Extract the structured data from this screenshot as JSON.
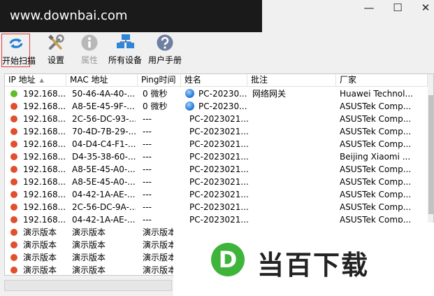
{
  "watermark": {
    "url_text": "www.downbai.com",
    "logo_letter": "D",
    "logo_text": "当百下载"
  },
  "window": {
    "minimize": "—",
    "maximize": "☐",
    "close": "✕"
  },
  "toolbar": {
    "start_scan": "开始扫描",
    "settings": "设置",
    "properties": "属性",
    "all_devices": "所有设备",
    "user_manual": "用户手册"
  },
  "columns": [
    "IP 地址",
    "MAC 地址",
    "Ping时间",
    "姓名",
    "批注",
    "厂家"
  ],
  "rows": [
    {
      "status": "green",
      "ip": "192.168...",
      "mac": "50-46-4A-40-...",
      "ping": "0 微秒",
      "name": "PC-20230...",
      "has_globe": true,
      "note": "网络网关",
      "vendor": "Huawei Technol..."
    },
    {
      "status": "red",
      "ip": "192.168...",
      "mac": "A8-5E-45-9F-...",
      "ping": "0 微秒",
      "name": "PC-20230...",
      "has_globe": true,
      "note": "",
      "vendor": "ASUSTek Comp..."
    },
    {
      "status": "red",
      "ip": "192.168...",
      "mac": "2C-56-DC-93-...",
      "ping": "---",
      "name": "PC-2023021...",
      "has_globe": false,
      "note": "",
      "vendor": "ASUSTek Comp..."
    },
    {
      "status": "red",
      "ip": "192.168...",
      "mac": "70-4D-7B-29-...",
      "ping": "---",
      "name": "PC-2023021...",
      "has_globe": false,
      "note": "",
      "vendor": "ASUSTek Comp..."
    },
    {
      "status": "red",
      "ip": "192.168...",
      "mac": "04-D4-C4-F1-...",
      "ping": "---",
      "name": "PC-2023021...",
      "has_globe": false,
      "note": "",
      "vendor": "ASUSTek Comp..."
    },
    {
      "status": "red",
      "ip": "192.168...",
      "mac": "D4-35-38-60-...",
      "ping": "---",
      "name": "PC-2023021...",
      "has_globe": false,
      "note": "",
      "vendor": "Beijing Xiaomi ..."
    },
    {
      "status": "red",
      "ip": "192.168...",
      "mac": "A8-5E-45-A0-...",
      "ping": "---",
      "name": "PC-2023021...",
      "has_globe": false,
      "note": "",
      "vendor": "ASUSTek Comp..."
    },
    {
      "status": "red",
      "ip": "192.168...",
      "mac": "A8-5E-45-A0-...",
      "ping": "---",
      "name": "PC-2023021...",
      "has_globe": false,
      "note": "",
      "vendor": "ASUSTek Comp..."
    },
    {
      "status": "red",
      "ip": "192.168...",
      "mac": "04-42-1A-AE-...",
      "ping": "---",
      "name": "PC-2023021...",
      "has_globe": false,
      "note": "",
      "vendor": "ASUSTek Comp..."
    },
    {
      "status": "red",
      "ip": "192.168...",
      "mac": "2C-56-DC-9A-...",
      "ping": "---",
      "name": "PC-2023021...",
      "has_globe": false,
      "note": "",
      "vendor": "ASUSTek Comp..."
    },
    {
      "status": "red",
      "ip": "192.168...",
      "mac": "04-42-1A-AE-...",
      "ping": "---",
      "name": "PC-2023021...",
      "has_globe": false,
      "note": "",
      "vendor": "ASUSTek Comp..."
    },
    {
      "status": "red",
      "ip": "演示版本",
      "mac": "演示版本",
      "ping": "演示版本",
      "name": "",
      "has_globe": false,
      "note": "",
      "vendor": ""
    },
    {
      "status": "red",
      "ip": "演示版本",
      "mac": "演示版本",
      "ping": "演示版本",
      "name": "",
      "has_globe": false,
      "note": "",
      "vendor": ""
    },
    {
      "status": "red",
      "ip": "演示版本",
      "mac": "演示版本",
      "ping": "演示版本",
      "name": "",
      "has_globe": false,
      "note": "",
      "vendor": ""
    },
    {
      "status": "red",
      "ip": "演示版本",
      "mac": "演示版本",
      "ping": "演示版本",
      "name": "",
      "has_globe": false,
      "note": "",
      "vendor": ""
    }
  ],
  "colors": {
    "status_green": "#5cbf2a",
    "status_red": "#e0502e",
    "highlight_border": "#e03a3a"
  }
}
